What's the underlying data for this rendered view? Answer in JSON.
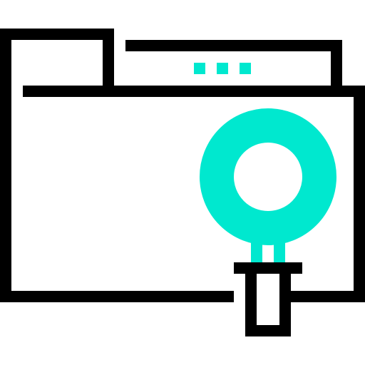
{
  "icon": {
    "name": "folder-search-icon",
    "colors": {
      "outline": "#000000",
      "accent": "#00E8CF",
      "background": "#FFFFFF"
    }
  }
}
